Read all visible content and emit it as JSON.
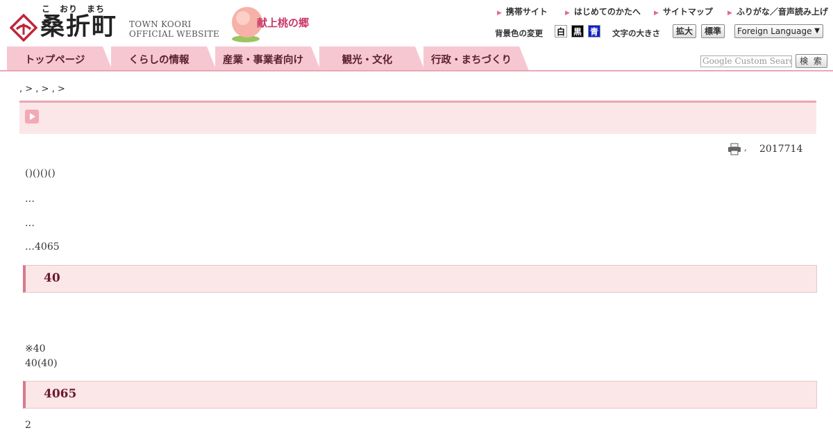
{
  "site": {
    "furigana": "こ　おり　まち",
    "name": "桑折町",
    "english_line1": "TOWN KOORI",
    "english_line2": "OFFICIAL WEBSITE",
    "tagline": "献上桃の郷"
  },
  "top_links": [
    "携帯サイト",
    "はじめてのかたへ",
    "サイトマップ",
    "ふりがな／音声読み上げ"
  ],
  "utility": {
    "bg_color_label": "背景色の変更",
    "bg_colors": [
      "白",
      "黒",
      "青"
    ],
    "font_size_label": "文字の大きさ",
    "enlarge": "拡大",
    "standard": "標準",
    "language": "Foreign Language"
  },
  "nav": {
    "tabs": [
      "トップページ",
      "くらしの情報",
      "産業・事業者向け",
      "観光・文化",
      "行政・まちづくり"
    ]
  },
  "search": {
    "placeholder": "Google Custom Search",
    "button": "検 索"
  },
  "breadcrumb": ", > , > , >",
  "article": {
    "print_sep": ",",
    "updated": "2017714",
    "p1": "()()()()",
    "p2": "…",
    "p3": "…",
    "p4": "…4065",
    "heading1": "40",
    "p5": "※40",
    "p6": "40(40)",
    "heading2": "4065",
    "p7": "2"
  },
  "colors": {
    "accent_pink": "#e8a6b6",
    "band_pink": "#fbe6e8",
    "heading_text": "#6a1a2a"
  },
  "icons": [
    "town-emblem-icon",
    "peach-icon",
    "arrow-right-icon",
    "play-icon",
    "printer-icon",
    "chevron-down-icon"
  ]
}
